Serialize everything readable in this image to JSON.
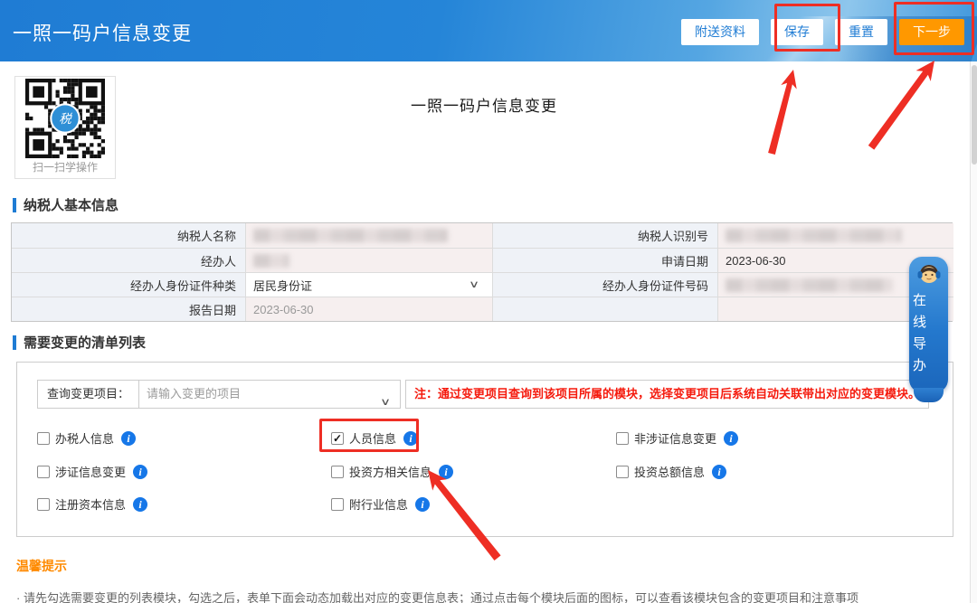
{
  "header": {
    "title": "一照一码户信息变更",
    "buttons": {
      "attach": "附送资料",
      "save": "保存",
      "reset": "重置",
      "next": "下一步"
    }
  },
  "qr": {
    "caption": "扫一扫学操作",
    "center_label": "税"
  },
  "page_title": "一照一码户信息变更",
  "basic_info": {
    "section_title": "纳税人基本信息",
    "rows": [
      {
        "l_label": "纳税人名称",
        "l_value": "",
        "r_label": "纳税人识别号",
        "r_value": ""
      },
      {
        "l_label": "经办人",
        "l_value": "",
        "r_label": "申请日期",
        "r_value": "2023-06-30"
      },
      {
        "l_label": "经办人身份证件种类",
        "l_value": "居民身份证",
        "r_label": "经办人身份证件号码",
        "r_value": ""
      },
      {
        "l_label": "报告日期",
        "l_value": "2023-06-30",
        "r_label": "",
        "r_value": ""
      }
    ]
  },
  "change_list": {
    "section_title": "需要变更的清单列表",
    "query": {
      "label": "查询变更项目：",
      "placeholder": "请输入变更的项目",
      "note": "注：通过变更项目查询到该项目所属的模块，选择变更项目后系统自动关联带出对应的变更模块。"
    },
    "items": [
      {
        "label": "办税人信息",
        "checked": false
      },
      {
        "label": "人员信息",
        "checked": true
      },
      {
        "label": "非涉证信息变更",
        "checked": false
      },
      {
        "label": "涉证信息变更",
        "checked": false
      },
      {
        "label": "投资方相关信息",
        "checked": false
      },
      {
        "label": "投资总额信息",
        "checked": false
      },
      {
        "label": "注册资本信息",
        "checked": false
      },
      {
        "label": "附行业信息",
        "checked": false
      }
    ],
    "checkmark": "✓"
  },
  "tips": {
    "title": "温馨提示",
    "line": "· 请先勾选需要变更的列表模块，勾选之后，表单下面会动态加载出对应的变更信息表；通过点击每个模块后面的图标，可以查看该模块包含的变更项目和注意事项"
  },
  "widget": {
    "label": "在线导办"
  },
  "colors": {
    "header_blue": "#1f7cd4",
    "button_orange": "#ff9800",
    "annotation_red": "#ee2e24",
    "info_icon_blue": "#1677e8",
    "note_red": "#f51a0d",
    "tips_orange": "#ff8a00"
  }
}
